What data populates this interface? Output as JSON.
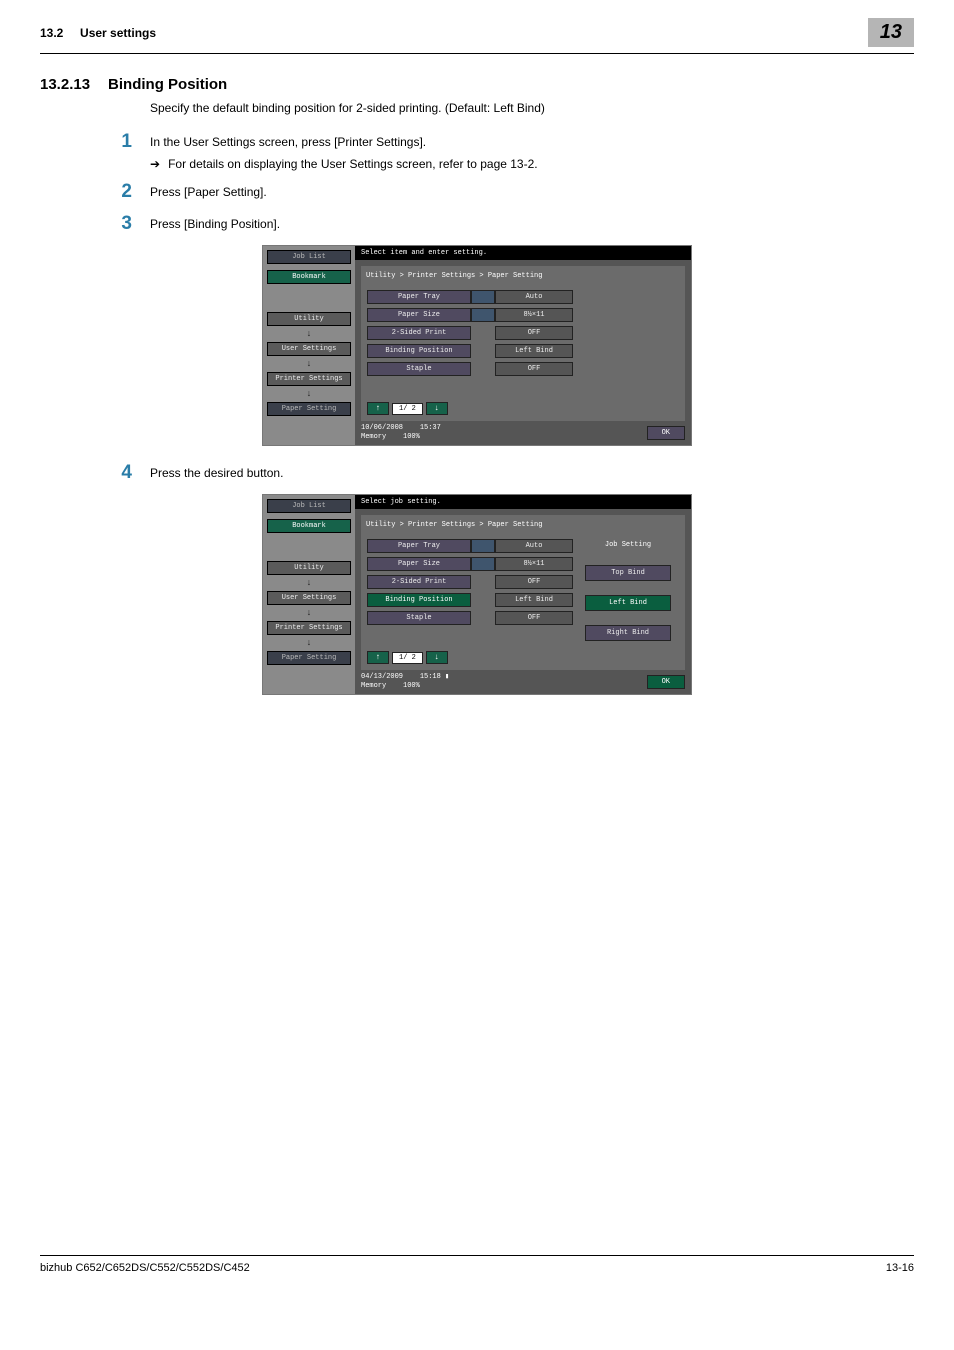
{
  "header": {
    "section_ref": "13.2",
    "section_name": "User settings",
    "chapter_badge": "13"
  },
  "section": {
    "number": "13.2.13",
    "title": "Binding Position"
  },
  "intro": "Specify the default binding position for 2-sided printing. (Default: Left Bind)",
  "steps": {
    "s1": {
      "num": "1",
      "text": "In the User Settings screen, press [Printer Settings].",
      "sub": "For details on displaying the User Settings screen, refer to page 13-2."
    },
    "s2": {
      "num": "2",
      "text": "Press [Paper Setting]."
    },
    "s3": {
      "num": "3",
      "text": "Press [Binding Position]."
    },
    "s4": {
      "num": "4",
      "text": "Press the desired button."
    }
  },
  "screenshot1": {
    "topbar": "Select item and enter setting.",
    "breadcrumb": "Utility > Printer Settings > Paper Setting",
    "side": {
      "joblist": "Job List",
      "bookmark": "Bookmark",
      "utility": "Utility",
      "usersettings": "User Settings",
      "printersettings": "Printer Settings",
      "papersetting": "Paper Setting"
    },
    "rows": {
      "r1": {
        "label": "Paper Tray",
        "value": "Auto"
      },
      "r2": {
        "label": "Paper Size",
        "value": "8½×11"
      },
      "r3": {
        "label": "2-Sided Print",
        "value": "OFF"
      },
      "r4": {
        "label": "Binding Position",
        "value": "Left Bind"
      },
      "r5": {
        "label": "Staple",
        "value": "OFF"
      }
    },
    "pager": "1/ 2",
    "footer": {
      "date": "10/06/2008",
      "time": "15:37",
      "memory_label": "Memory",
      "memory_value": "100%",
      "ok": "OK"
    }
  },
  "screenshot2": {
    "topbar": "Select job setting.",
    "breadcrumb": "Utility > Printer Settings > Paper Setting",
    "side": {
      "joblist": "Job List",
      "bookmark": "Bookmark",
      "utility": "Utility",
      "usersettings": "User Settings",
      "printersettings": "Printer Settings",
      "papersetting": "Paper Setting"
    },
    "rows": {
      "r1": {
        "label": "Paper Tray",
        "value": "Auto"
      },
      "r2": {
        "label": "Paper Size",
        "value": "8½×11"
      },
      "r3": {
        "label": "2-Sided Print",
        "value": "OFF"
      },
      "r4": {
        "label": "Binding Position",
        "value": "Left Bind"
      },
      "r5": {
        "label": "Staple",
        "value": "OFF"
      }
    },
    "right": {
      "header": "Job Setting",
      "b1": "Top Bind",
      "b2": "Left Bind",
      "b3": "Right Bind"
    },
    "pager": "1/ 2",
    "footer": {
      "date": "04/13/2009",
      "time": "15:18",
      "memory_label": "Memory",
      "memory_value": "100%",
      "ok": "OK"
    }
  },
  "footer": {
    "model": "bizhub C652/C652DS/C552/C552DS/C452",
    "page": "13-16"
  }
}
